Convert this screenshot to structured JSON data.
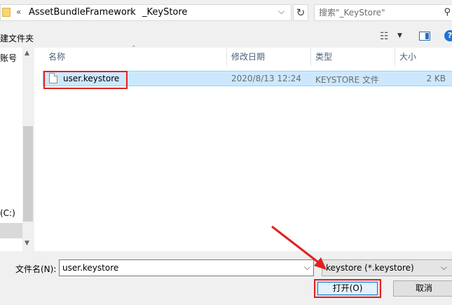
{
  "address": {
    "overflow_label": "«",
    "crumbs": [
      "AssetBundleFramework",
      "_KeyStore"
    ],
    "separator": "›",
    "dropdown": "⌵",
    "refresh": "↻"
  },
  "search": {
    "placeholder": "搜索\"_KeyStore\"",
    "icon": "search-icon",
    "glyph": "⚲"
  },
  "toolbar": {
    "new_folder": "建文件夹",
    "view_glyph": "☷",
    "view_dropdown": "▼",
    "help": "?"
  },
  "nav": {
    "items": [
      {
        "label": "账号"
      },
      {
        "label": "(C:)"
      }
    ],
    "scroll_up": "▲",
    "scroll_down": "▼"
  },
  "columns": [
    {
      "label": "名称"
    },
    {
      "label": "修改日期"
    },
    {
      "label": "类型"
    },
    {
      "label": "大小"
    }
  ],
  "sort_indicator": "˄",
  "files": [
    {
      "name": "user.keystore",
      "modified": "2020/8/13 12:24",
      "type": "KEYSTORE 文件",
      "size": "2 KB"
    }
  ],
  "footer": {
    "filename_label": "文件名(N):",
    "filename_value": "user.keystore",
    "filetype_value": "keystore (*.keystore)",
    "dropdown": "⌵",
    "open_label": "打开(O)",
    "cancel_label": "取消"
  },
  "colors": {
    "selection": "#cce8ff",
    "annotation": "#e32020",
    "accent": "#0078d7"
  }
}
